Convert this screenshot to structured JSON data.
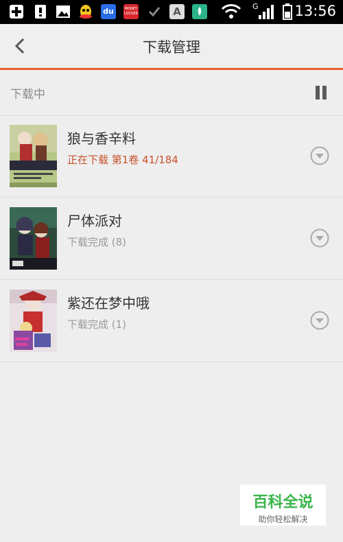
{
  "statusbar": {
    "time": "13:56",
    "icons": [
      "add-icon",
      "alert-icon",
      "gallery-icon",
      "qq-icon",
      "baidu-icon",
      "moneylocker-icon",
      "check-icon",
      "font-icon",
      "huawei-icon",
      "wifi-icon",
      "signal-icon",
      "battery-icon"
    ],
    "moneylocker_text": "MONEY LOCKER",
    "baidu_text": "du",
    "font_text": "A",
    "signal_type": "G"
  },
  "appbar": {
    "title": "下载管理"
  },
  "section": {
    "label": "下载中"
  },
  "downloads": [
    {
      "title": "狼与香辛料",
      "status": "正在下载 第1卷 41/184",
      "active": true
    },
    {
      "title": "尸体派对",
      "status": "下载完成 (8)",
      "active": false
    },
    {
      "title": "紫还在梦中哦",
      "status": "下载完成 (1)",
      "active": false
    }
  ],
  "watermark": {
    "title": "百科全说",
    "subtitle": "助你轻松解决"
  },
  "colors": {
    "accent": "#e8602c",
    "active_status": "#c8512c",
    "watermark_green": "#3ab54a"
  }
}
